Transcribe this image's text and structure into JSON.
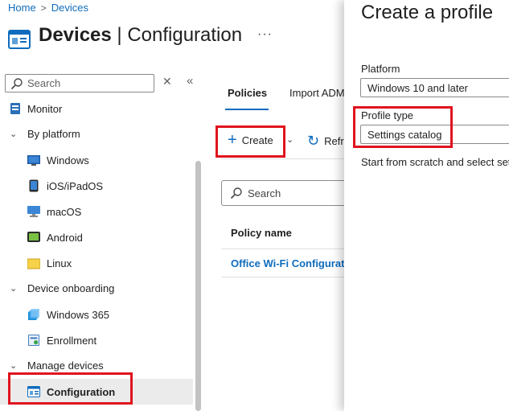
{
  "breadcrumb": {
    "home": "Home",
    "separator": ">",
    "current": "Devices"
  },
  "header": {
    "title_bold": "Devices",
    "title_divider": "|",
    "title_rest": "Configuration",
    "more": "···"
  },
  "sidebar": {
    "search_placeholder": "Search",
    "clear_glyph": "✕",
    "collapse_glyph": "«",
    "items": [
      {
        "label": "Monitor"
      },
      {
        "label": "By platform"
      },
      {
        "label": "Windows"
      },
      {
        "label": "iOS/iPadOS"
      },
      {
        "label": "macOS"
      },
      {
        "label": "Android"
      },
      {
        "label": "Linux"
      },
      {
        "label": "Device onboarding"
      },
      {
        "label": "Windows 365"
      },
      {
        "label": "Enrollment"
      },
      {
        "label": "Manage devices"
      },
      {
        "label": "Configuration"
      }
    ]
  },
  "main": {
    "tabs": [
      {
        "label": "Policies"
      },
      {
        "label": "Import ADM"
      }
    ],
    "toolbar": {
      "create": "Create",
      "refresh": "Refr"
    },
    "search_placeholder": "Search",
    "table": {
      "column": "Policy name",
      "rows": [
        "Office Wi-Fi Configurati"
      ]
    }
  },
  "panel": {
    "title": "Create a profile",
    "platform_label": "Platform",
    "platform_value": "Windows 10 and later",
    "profile_type_label": "Profile type",
    "profile_type_value": "Settings catalog",
    "description": "Start from scratch and select set"
  },
  "colors": {
    "accent": "#0f6cbd",
    "highlight": "#e0141e",
    "selected_bg": "#ebebeb"
  }
}
